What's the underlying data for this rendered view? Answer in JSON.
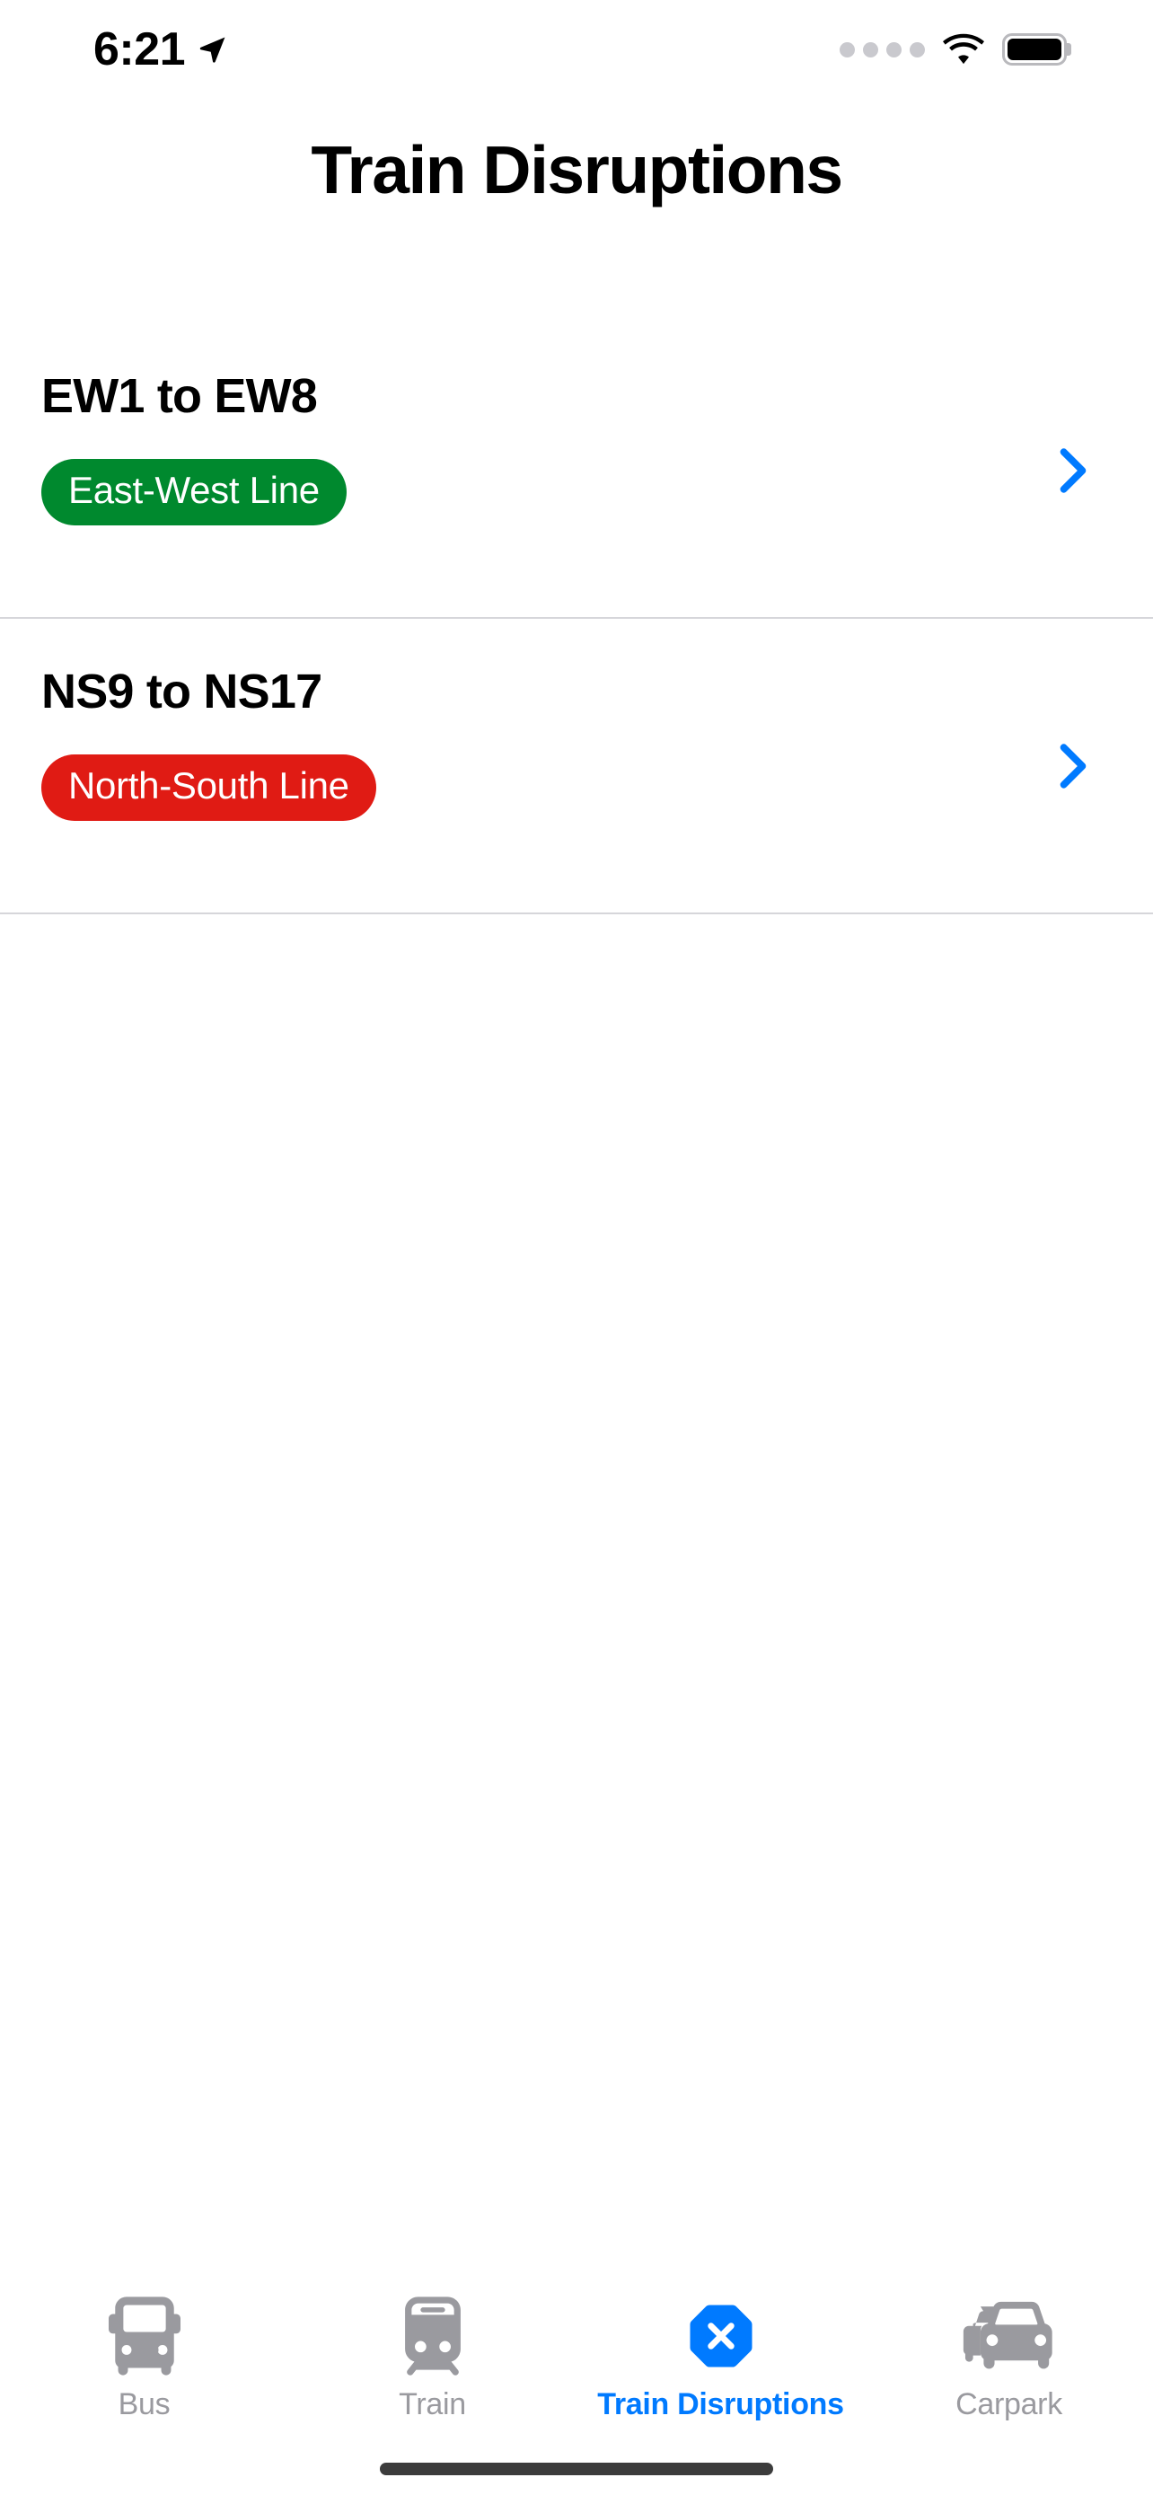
{
  "status_bar": {
    "time": "6:21",
    "location_icon": "location-arrow-icon",
    "cellular_icon": "cellular-dots-icon",
    "wifi_icon": "wifi-icon",
    "battery_icon": "battery-full-icon"
  },
  "header": {
    "title": "Train Disruptions"
  },
  "colors": {
    "accent_blue": "#007AFF",
    "east_west_green": "#00892E",
    "north_south_red": "#E01B14",
    "inactive_gray": "#9A9A9F",
    "separator": "#D6D6DA"
  },
  "list": {
    "rows": [
      {
        "title": "EW1 to EW8",
        "badge": "East-West Line",
        "badge_color": "#00892E",
        "chevron": "chevron-right-icon"
      },
      {
        "title": "NS9 to NS17",
        "badge": "North-South Line",
        "badge_color": "#E01B14",
        "chevron": "chevron-right-icon"
      }
    ]
  },
  "tab_bar": {
    "tabs": [
      {
        "label": "Bus",
        "icon": "bus-icon",
        "active": false
      },
      {
        "label": "Train",
        "icon": "train-icon",
        "active": false
      },
      {
        "label": "Train Disruptions",
        "icon": "disruption-octagon-x-icon",
        "active": true
      },
      {
        "label": "Carpark",
        "icon": "carpark-cars-icon",
        "active": false
      }
    ]
  }
}
